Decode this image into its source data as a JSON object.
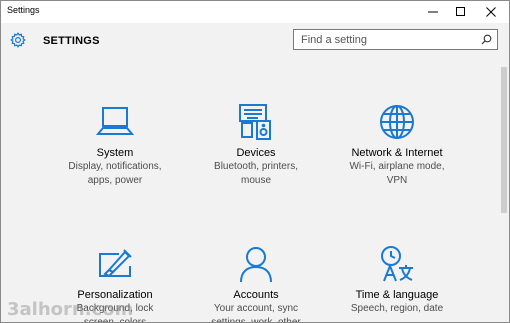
{
  "window": {
    "title": "Settings"
  },
  "header": {
    "title": "SETTINGS"
  },
  "search": {
    "placeholder": "Find a setting"
  },
  "tiles": [
    {
      "name": "System",
      "desc": "Display, notifications,\napps, power",
      "icon": "laptop-icon"
    },
    {
      "name": "Devices",
      "desc": "Bluetooth, printers,\nmouse",
      "icon": "devices-icon"
    },
    {
      "name": "Network & Internet",
      "desc": "Wi-Fi, airplane mode,\nVPN",
      "icon": "globe-icon"
    },
    {
      "name": "Personalization",
      "desc": "Background, lock\nscreen, colors",
      "icon": "personalization-icon"
    },
    {
      "name": "Accounts",
      "desc": "Your account, sync\nsettings, work, other",
      "icon": "person-icon"
    },
    {
      "name": "Time & language",
      "desc": "Speech, region, date",
      "icon": "time-language-icon"
    }
  ],
  "watermark": "3alhorn.com",
  "colors": {
    "accent": "#1a7ad1",
    "background": "#f2f2f2"
  }
}
